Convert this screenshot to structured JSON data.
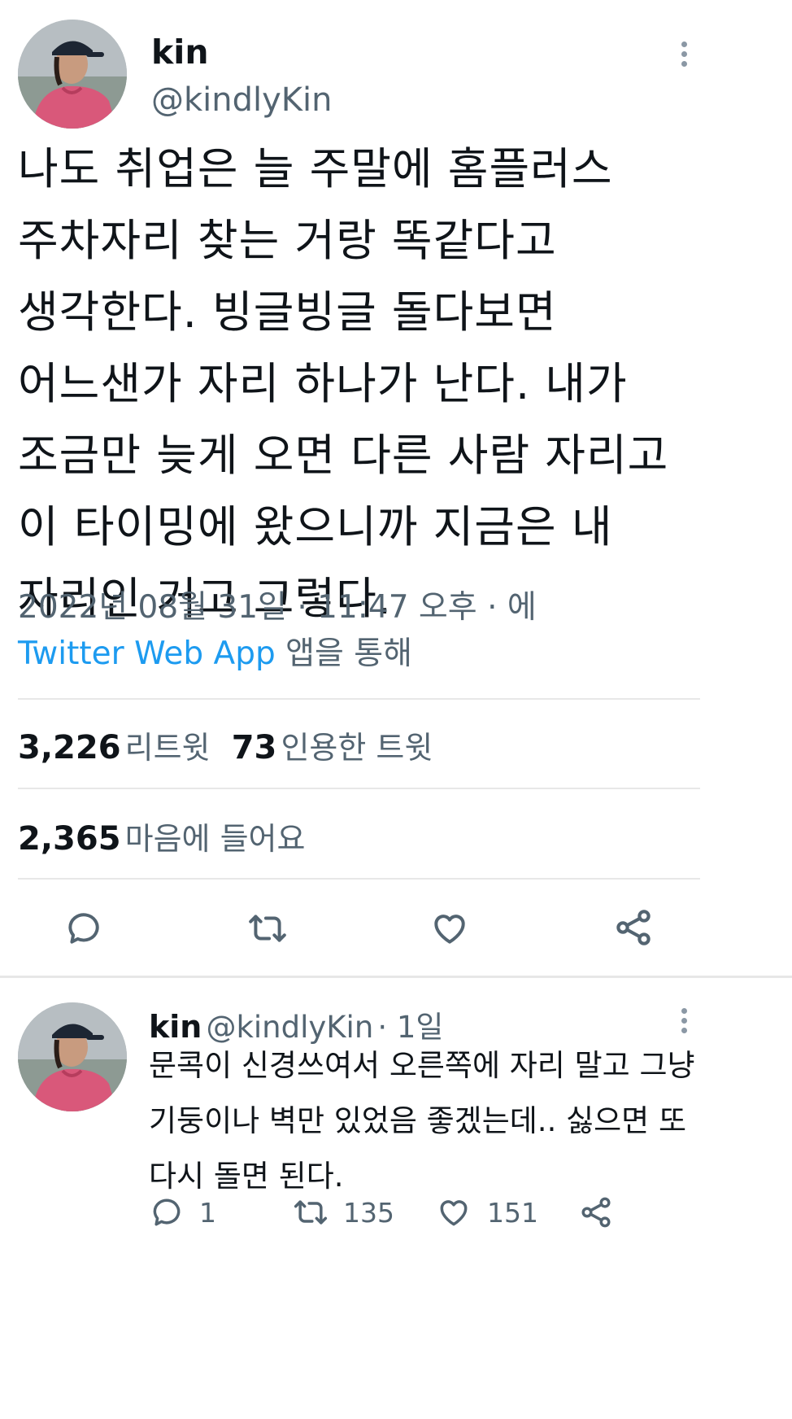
{
  "main_tweet": {
    "author": {
      "name": "kin",
      "handle": "@kindlyKin"
    },
    "text": "나도 취업은 늘 주말에 홈플러스\n주차자리 찾는 거랑 똑같다고\n생각한다. 빙글빙글 돌다보면\n어느샌가 자리 하나가 난다. 내가\n조금만 늦게 오면 다른 사람 자리고\n이 타이밍에 왔으니까 지금은 내\n자리인 거고 그렇다.",
    "timestamp": "2022년 08월 31일 · 11:47 오후 · 에",
    "source_app": "Twitter Web App",
    "source_suffix": "앱을 통해",
    "stats": {
      "retweets_count": "3,226",
      "retweets_label": "리트윗",
      "quotes_count": "73",
      "quotes_label": "인용한 트윗",
      "likes_count": "2,365",
      "likes_label": "마음에 들어요"
    },
    "action_icons": [
      "reply-icon",
      "retweet-icon",
      "like-icon",
      "share-icon"
    ]
  },
  "reply_tweet": {
    "author": {
      "name": "kin",
      "handle": "@kindlyKin",
      "time": "· 1일"
    },
    "text": "문콕이 신경쓰여서 오른쪽에 자리 말고 그냥\n기둥이나 벽만 있었음 좋겠는데.. 싫으면 또\n다시 돌면 된다.",
    "counts": {
      "reply": "1",
      "retweet": "135",
      "like": "151"
    }
  },
  "colors": {
    "accent": "#1d9bf0",
    "secondary_text": "#536471",
    "divider": "#e7e7e7"
  }
}
